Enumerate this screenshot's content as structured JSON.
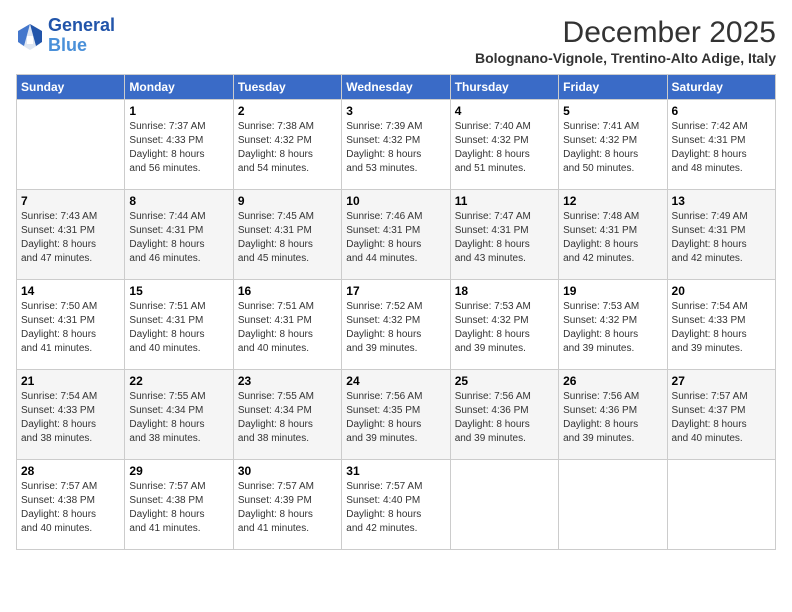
{
  "app": {
    "logo_line1": "General",
    "logo_line2": "Blue"
  },
  "header": {
    "month_year": "December 2025",
    "location": "Bolognano-Vignole, Trentino-Alto Adige, Italy"
  },
  "weekdays": [
    "Sunday",
    "Monday",
    "Tuesday",
    "Wednesday",
    "Thursday",
    "Friday",
    "Saturday"
  ],
  "weeks": [
    [
      {
        "day": "",
        "info": ""
      },
      {
        "day": "1",
        "info": "Sunrise: 7:37 AM\nSunset: 4:33 PM\nDaylight: 8 hours\nand 56 minutes."
      },
      {
        "day": "2",
        "info": "Sunrise: 7:38 AM\nSunset: 4:32 PM\nDaylight: 8 hours\nand 54 minutes."
      },
      {
        "day": "3",
        "info": "Sunrise: 7:39 AM\nSunset: 4:32 PM\nDaylight: 8 hours\nand 53 minutes."
      },
      {
        "day": "4",
        "info": "Sunrise: 7:40 AM\nSunset: 4:32 PM\nDaylight: 8 hours\nand 51 minutes."
      },
      {
        "day": "5",
        "info": "Sunrise: 7:41 AM\nSunset: 4:32 PM\nDaylight: 8 hours\nand 50 minutes."
      },
      {
        "day": "6",
        "info": "Sunrise: 7:42 AM\nSunset: 4:31 PM\nDaylight: 8 hours\nand 48 minutes."
      }
    ],
    [
      {
        "day": "7",
        "info": "Sunrise: 7:43 AM\nSunset: 4:31 PM\nDaylight: 8 hours\nand 47 minutes."
      },
      {
        "day": "8",
        "info": "Sunrise: 7:44 AM\nSunset: 4:31 PM\nDaylight: 8 hours\nand 46 minutes."
      },
      {
        "day": "9",
        "info": "Sunrise: 7:45 AM\nSunset: 4:31 PM\nDaylight: 8 hours\nand 45 minutes."
      },
      {
        "day": "10",
        "info": "Sunrise: 7:46 AM\nSunset: 4:31 PM\nDaylight: 8 hours\nand 44 minutes."
      },
      {
        "day": "11",
        "info": "Sunrise: 7:47 AM\nSunset: 4:31 PM\nDaylight: 8 hours\nand 43 minutes."
      },
      {
        "day": "12",
        "info": "Sunrise: 7:48 AM\nSunset: 4:31 PM\nDaylight: 8 hours\nand 42 minutes."
      },
      {
        "day": "13",
        "info": "Sunrise: 7:49 AM\nSunset: 4:31 PM\nDaylight: 8 hours\nand 42 minutes."
      }
    ],
    [
      {
        "day": "14",
        "info": "Sunrise: 7:50 AM\nSunset: 4:31 PM\nDaylight: 8 hours\nand 41 minutes."
      },
      {
        "day": "15",
        "info": "Sunrise: 7:51 AM\nSunset: 4:31 PM\nDaylight: 8 hours\nand 40 minutes."
      },
      {
        "day": "16",
        "info": "Sunrise: 7:51 AM\nSunset: 4:31 PM\nDaylight: 8 hours\nand 40 minutes."
      },
      {
        "day": "17",
        "info": "Sunrise: 7:52 AM\nSunset: 4:32 PM\nDaylight: 8 hours\nand 39 minutes."
      },
      {
        "day": "18",
        "info": "Sunrise: 7:53 AM\nSunset: 4:32 PM\nDaylight: 8 hours\nand 39 minutes."
      },
      {
        "day": "19",
        "info": "Sunrise: 7:53 AM\nSunset: 4:32 PM\nDaylight: 8 hours\nand 39 minutes."
      },
      {
        "day": "20",
        "info": "Sunrise: 7:54 AM\nSunset: 4:33 PM\nDaylight: 8 hours\nand 39 minutes."
      }
    ],
    [
      {
        "day": "21",
        "info": "Sunrise: 7:54 AM\nSunset: 4:33 PM\nDaylight: 8 hours\nand 38 minutes."
      },
      {
        "day": "22",
        "info": "Sunrise: 7:55 AM\nSunset: 4:34 PM\nDaylight: 8 hours\nand 38 minutes."
      },
      {
        "day": "23",
        "info": "Sunrise: 7:55 AM\nSunset: 4:34 PM\nDaylight: 8 hours\nand 38 minutes."
      },
      {
        "day": "24",
        "info": "Sunrise: 7:56 AM\nSunset: 4:35 PM\nDaylight: 8 hours\nand 39 minutes."
      },
      {
        "day": "25",
        "info": "Sunrise: 7:56 AM\nSunset: 4:36 PM\nDaylight: 8 hours\nand 39 minutes."
      },
      {
        "day": "26",
        "info": "Sunrise: 7:56 AM\nSunset: 4:36 PM\nDaylight: 8 hours\nand 39 minutes."
      },
      {
        "day": "27",
        "info": "Sunrise: 7:57 AM\nSunset: 4:37 PM\nDaylight: 8 hours\nand 40 minutes."
      }
    ],
    [
      {
        "day": "28",
        "info": "Sunrise: 7:57 AM\nSunset: 4:38 PM\nDaylight: 8 hours\nand 40 minutes."
      },
      {
        "day": "29",
        "info": "Sunrise: 7:57 AM\nSunset: 4:38 PM\nDaylight: 8 hours\nand 41 minutes."
      },
      {
        "day": "30",
        "info": "Sunrise: 7:57 AM\nSunset: 4:39 PM\nDaylight: 8 hours\nand 41 minutes."
      },
      {
        "day": "31",
        "info": "Sunrise: 7:57 AM\nSunset: 4:40 PM\nDaylight: 8 hours\nand 42 minutes."
      },
      {
        "day": "",
        "info": ""
      },
      {
        "day": "",
        "info": ""
      },
      {
        "day": "",
        "info": ""
      }
    ]
  ]
}
